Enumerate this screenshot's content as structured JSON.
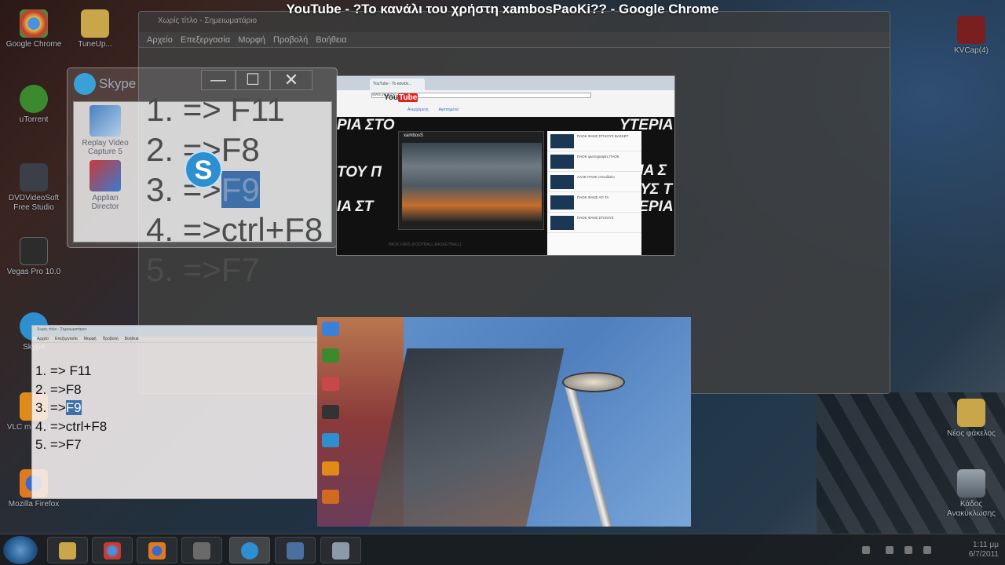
{
  "window_title": "YouTube - ?Το κανάλι του χρήστη xambosPaoKi?? - Google Chrome",
  "desktop_icons": [
    {
      "label": "Google Chrome",
      "icon": "chrome-icon"
    },
    {
      "label": "TuneUp...",
      "icon": "folder-icon"
    },
    {
      "label": "uTorrent",
      "icon": "utorrent-icon"
    },
    {
      "label": "DVDVideoSoft Free Studio",
      "icon": "dvdvideosoft-icon"
    },
    {
      "label": "Vegas Pro 10.0",
      "icon": "vegas-icon"
    },
    {
      "label": "Skype",
      "icon": "skype-icon"
    },
    {
      "label": "VLC media pl...",
      "icon": "vlc-icon"
    },
    {
      "label": "Mozilla Firefox",
      "icon": "firefox-icon"
    },
    {
      "label": "KVCap(4)",
      "icon": "app-icon"
    },
    {
      "label": "Νέος φάκελος",
      "icon": "folder-icon"
    },
    {
      "label": "Κάδος Ανακύκλωσης",
      "icon": "recycle-bin-icon"
    }
  ],
  "notepad": {
    "title": "Χωρίς τίτλο - Σημειωματάριο",
    "menu": [
      "Αρχείο",
      "Επεξεργασία",
      "Μορφή",
      "Προβολή",
      "Βοήθεια"
    ]
  },
  "shortcut_steps": [
    "1. => F11",
    "2. =>F8",
    "3. =>",
    "4. =>ctrl+F8",
    "5. =>F7"
  ],
  "highlighted_key": "F9",
  "skype": {
    "title": "Skype",
    "minimize": "—",
    "maximize": "☐",
    "close": "✕",
    "apps": [
      {
        "label": "Replay Video Capture 5"
      },
      {
        "label": "Applian Director"
      }
    ]
  },
  "youtube": {
    "tab_label": "YouTube - Το κανάλι...",
    "url": "www.youtube.com/",
    "logo": "You",
    "logo_box": "Tube",
    "channel_name": "xambosS",
    "banner_words": [
      "ΡΙΑ ΣΤΟ",
      "ΤΟΥ Π",
      "ΙΑ ΣΤ",
      "ΥΤΕΡΙΑ",
      "ΕΡΙΑ Σ",
      "ΔΟΥΣ Τ",
      "ΥΤΕΡΙΑ"
    ],
    "video_title": "paOk fans",
    "channel_tabs": [
      "Ανερχόμενη",
      "Αγαπημένα"
    ],
    "sidebar_videos": [
      "ΠΑΟΚ ΦΑΝΣ ΣΤΙΧΟΥΣ ΒΑΣΚΕΤ",
      "ΠΑΟΚ φωτογραφίες ΠΑΟΚ",
      "ΑΛΛΕ ΠΑΟΚ σπουδαίοι",
      "ΠΑΟΚ ΦΑΝΣ ΑΠ ΤΑ",
      "ΠΑΟΚ ΦΑΝΣ ΣΤΙΧΟΥΣ"
    ],
    "footer": "PAOK FANS (FOOTBALL-BASKETBALL)"
  },
  "notepad2": {
    "title": "Χωρίς τίτλο - Σημειωματάριο",
    "menu": [
      "Αρχείο",
      "Επεξεργασία",
      "Μορφή",
      "Προβολή",
      "Βοήθεια"
    ]
  },
  "taskbar": {
    "buttons": [
      {
        "icon": "explorer-icon"
      },
      {
        "icon": "chrome-icon"
      },
      {
        "icon": "firefox-icon"
      },
      {
        "icon": "media-player-icon"
      },
      {
        "icon": "skype-icon"
      },
      {
        "icon": "network-icon"
      },
      {
        "icon": "notepad-icon"
      }
    ],
    "time": "1:11 μμ",
    "date": "6/7/2011"
  }
}
